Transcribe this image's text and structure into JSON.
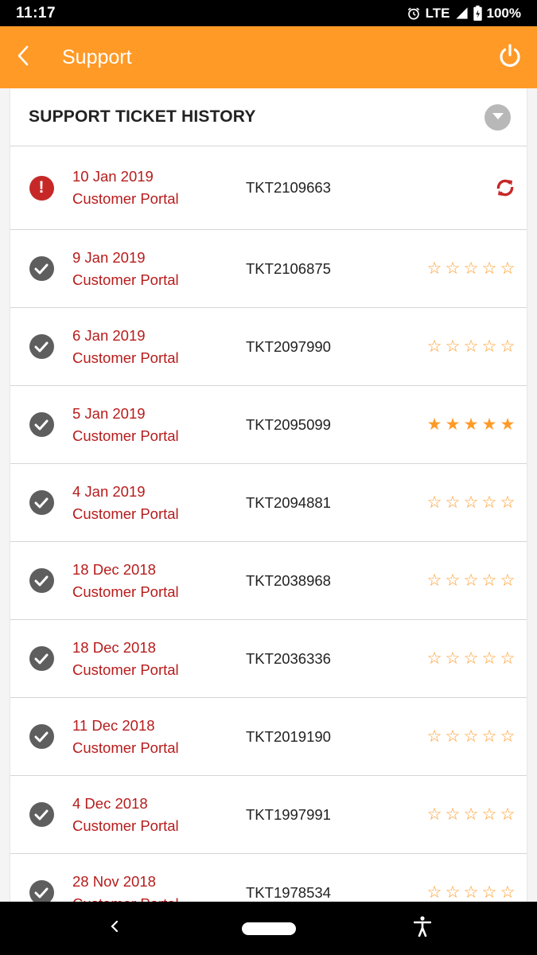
{
  "status_bar": {
    "time": "11:17",
    "network": "LTE",
    "battery": "100%"
  },
  "app_bar": {
    "title": "Support"
  },
  "card": {
    "title": "SUPPORT TICKET HISTORY"
  },
  "colors": {
    "accent": "#FF9A27",
    "date_text": "#b71c1c",
    "error": "#c62828",
    "done_icon": "#5e5e5e"
  },
  "tickets": [
    {
      "date": "10 Jan 2019",
      "source": "Customer Portal",
      "id": "TKT2109663",
      "status": "error",
      "rating": null
    },
    {
      "date": "9 Jan 2019",
      "source": "Customer Portal",
      "id": "TKT2106875",
      "status": "done",
      "rating": 0
    },
    {
      "date": "6 Jan 2019",
      "source": "Customer Portal",
      "id": "TKT2097990",
      "status": "done",
      "rating": 0
    },
    {
      "date": "5 Jan 2019",
      "source": "Customer Portal",
      "id": "TKT2095099",
      "status": "done",
      "rating": 5
    },
    {
      "date": "4 Jan 2019",
      "source": "Customer Portal",
      "id": "TKT2094881",
      "status": "done",
      "rating": 0
    },
    {
      "date": "18 Dec 2018",
      "source": "Customer Portal",
      "id": "TKT2038968",
      "status": "done",
      "rating": 0
    },
    {
      "date": "18 Dec 2018",
      "source": "Customer Portal",
      "id": "TKT2036336",
      "status": "done",
      "rating": 0
    },
    {
      "date": "11 Dec 2018",
      "source": "Customer Portal",
      "id": "TKT2019190",
      "status": "done",
      "rating": 0
    },
    {
      "date": "4 Dec 2018",
      "source": "Customer Portal",
      "id": "TKT1997991",
      "status": "done",
      "rating": 0
    },
    {
      "date": "28 Nov 2018",
      "source": "Customer Portal",
      "id": "TKT1978534",
      "status": "done",
      "rating": 0
    }
  ]
}
